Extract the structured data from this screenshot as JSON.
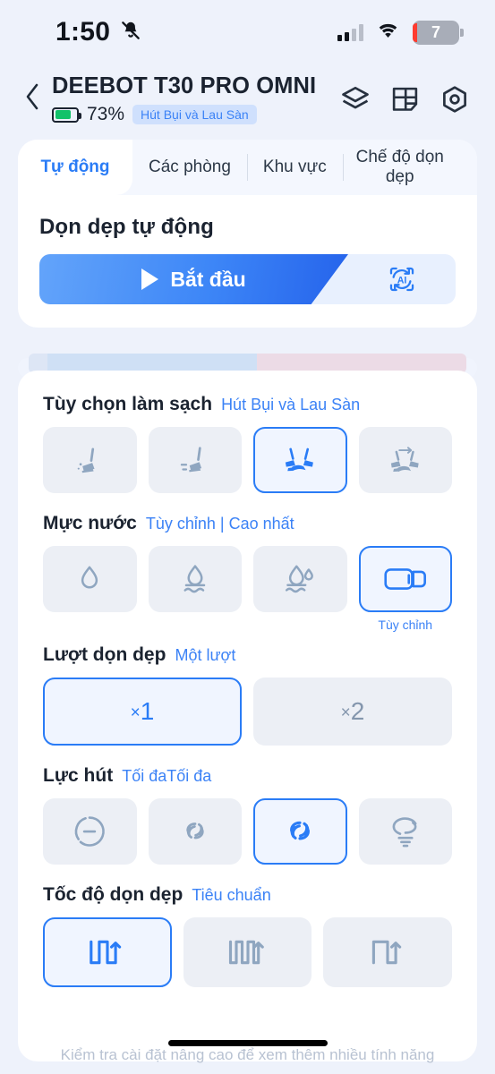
{
  "status_bar": {
    "time": "1:50",
    "mute_icon": "bell-muted-icon",
    "signal_icon": "cellular-signal-icon",
    "wifi_icon": "wifi-icon",
    "battery_level": "7"
  },
  "header": {
    "back_icon": "chevron-left-icon",
    "device_name": "DEEBOT T30 PRO OMNI",
    "battery_percent": "73%",
    "mode_tag": "Hút Bụi và Lau Sàn",
    "icons": [
      {
        "name": "layers-icon"
      },
      {
        "name": "map-grid-icon"
      },
      {
        "name": "settings-hexagon-icon"
      }
    ]
  },
  "tabs": [
    {
      "label": "Tự động",
      "active": true
    },
    {
      "label": "Các phòng",
      "active": false
    },
    {
      "label": "Khu vực",
      "active": false
    },
    {
      "label": "Chế độ dọn dẹp",
      "active": false
    }
  ],
  "auto_panel": {
    "title": "Dọn dẹp tự động",
    "start_label": "Bắt đầu",
    "play_icon": "play-icon",
    "ai_icon": "ai-refresh-icon",
    "ai_label": "AI"
  },
  "settings": {
    "clean_option": {
      "title": "Tùy chọn làm sạch",
      "value": "Hút Bụi và Lau Sàn",
      "options": [
        {
          "icon": "broom-vacuum-icon",
          "selected": false
        },
        {
          "icon": "broom-sweep-icon",
          "selected": false
        },
        {
          "icon": "broom-mop-dual-icon",
          "selected": true
        },
        {
          "icon": "broom-mop-after-icon",
          "selected": false
        }
      ]
    },
    "water_level": {
      "title": "Mực nước",
      "value": "Tùy chỉnh | Cao nhất",
      "options": [
        {
          "icon": "water-drop-low-icon",
          "selected": false,
          "label": ""
        },
        {
          "icon": "water-drop-medium-icon",
          "selected": false,
          "label": ""
        },
        {
          "icon": "water-drop-high-icon",
          "selected": false,
          "label": ""
        },
        {
          "icon": "water-custom-slider-icon",
          "selected": true,
          "label": "Tùy chỉnh"
        }
      ]
    },
    "passes": {
      "title": "Lượt dọn dẹp",
      "value": "Một lượt",
      "options": [
        {
          "label": "1",
          "prefix": "×",
          "selected": true
        },
        {
          "label": "2",
          "prefix": "×",
          "selected": false
        }
      ]
    },
    "suction": {
      "title": "Lực hút",
      "value": "Tối đaTối đa",
      "options": [
        {
          "icon": "suction-quiet-icon",
          "selected": false
        },
        {
          "icon": "suction-standard-icon",
          "selected": false
        },
        {
          "icon": "suction-strong-icon",
          "selected": true
        },
        {
          "icon": "suction-max-tornado-icon",
          "selected": false
        }
      ]
    },
    "speed": {
      "title": "Tốc độ dọn dẹp",
      "value": "Tiêu chuẩn",
      "options": [
        {
          "icon": "path-standard-icon",
          "selected": true
        },
        {
          "icon": "path-dense-icon",
          "selected": false
        },
        {
          "icon": "path-sparse-icon",
          "selected": false
        }
      ]
    }
  },
  "footer": {
    "note": "Kiểm tra cài đặt nâng cao để xem thêm nhiều tính năng"
  },
  "colors": {
    "accent": "#2a7cf6",
    "page_bg": "#eef2fb",
    "card_bg": "#ffffff",
    "chip_bg": "#eceff5",
    "battery_green": "#12c26a",
    "icon_gray": "#8496ad"
  }
}
